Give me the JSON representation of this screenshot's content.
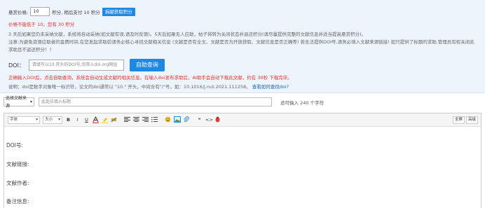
{
  "price": {
    "label": "悬赏价格:",
    "value": "10",
    "suffix": "积分, 稍后支付 10 积分",
    "earn_button": "捐献获取积分"
  },
  "warning": "价格不能低于 10，您有 30 积分",
  "notes": {
    "line1": "3 天后如果您仍未采纳文献，系统将自动采纳(如文献有误,请及时反馈)。5天后如果无人应助，帖子将转为关闭状态并退还积分(请尽量提供完整的文献信息并适当提高悬赏积分)。",
    "line2": "注意:为避免资源应助者的金费时间,在您发起求助前请务必核心寻找文献相关信息 (文献是否有全文、文献是否为开放获取、文献信息是否正确等) 若无法提供DOI号,请务必填入文献来源链接! 如只提供了标题的求助,管理员有权关闭此求助且不返还积分！！"
  },
  "doi": {
    "label": "DOI：",
    "placeholder": "请填写以10.开头的DOI号,勿带入doi.org网址",
    "query_button": "自助查询"
  },
  "tip": "正确输入DOI后，点击自助查询，系统会自动生成文献的相关信息。在输入doi发布求助后，AI助手会自动下载此文献，约在 30秒 下载完毕。",
  "help": {
    "text": "说明：doi是数字对象唯一标识符，论文的doi通常以 \"10.\" 开头，中间含有\"/\"号，如：10.1016/j.nut.2021.111258。",
    "link": "查看如何查找doi?"
  },
  "form": {
    "source_select": "选择文献来源",
    "title_placeholder": "此处应填入标题",
    "remaining": "还可输入 240 个字符"
  },
  "toolbar": {
    "font_select": "字体",
    "size_select": "大小",
    "fullscreen": "全屏",
    "advanced": "高级"
  },
  "editor_fields": [
    "DOI号:",
    "文献链接:",
    "文献作者:",
    "备注信息:"
  ]
}
